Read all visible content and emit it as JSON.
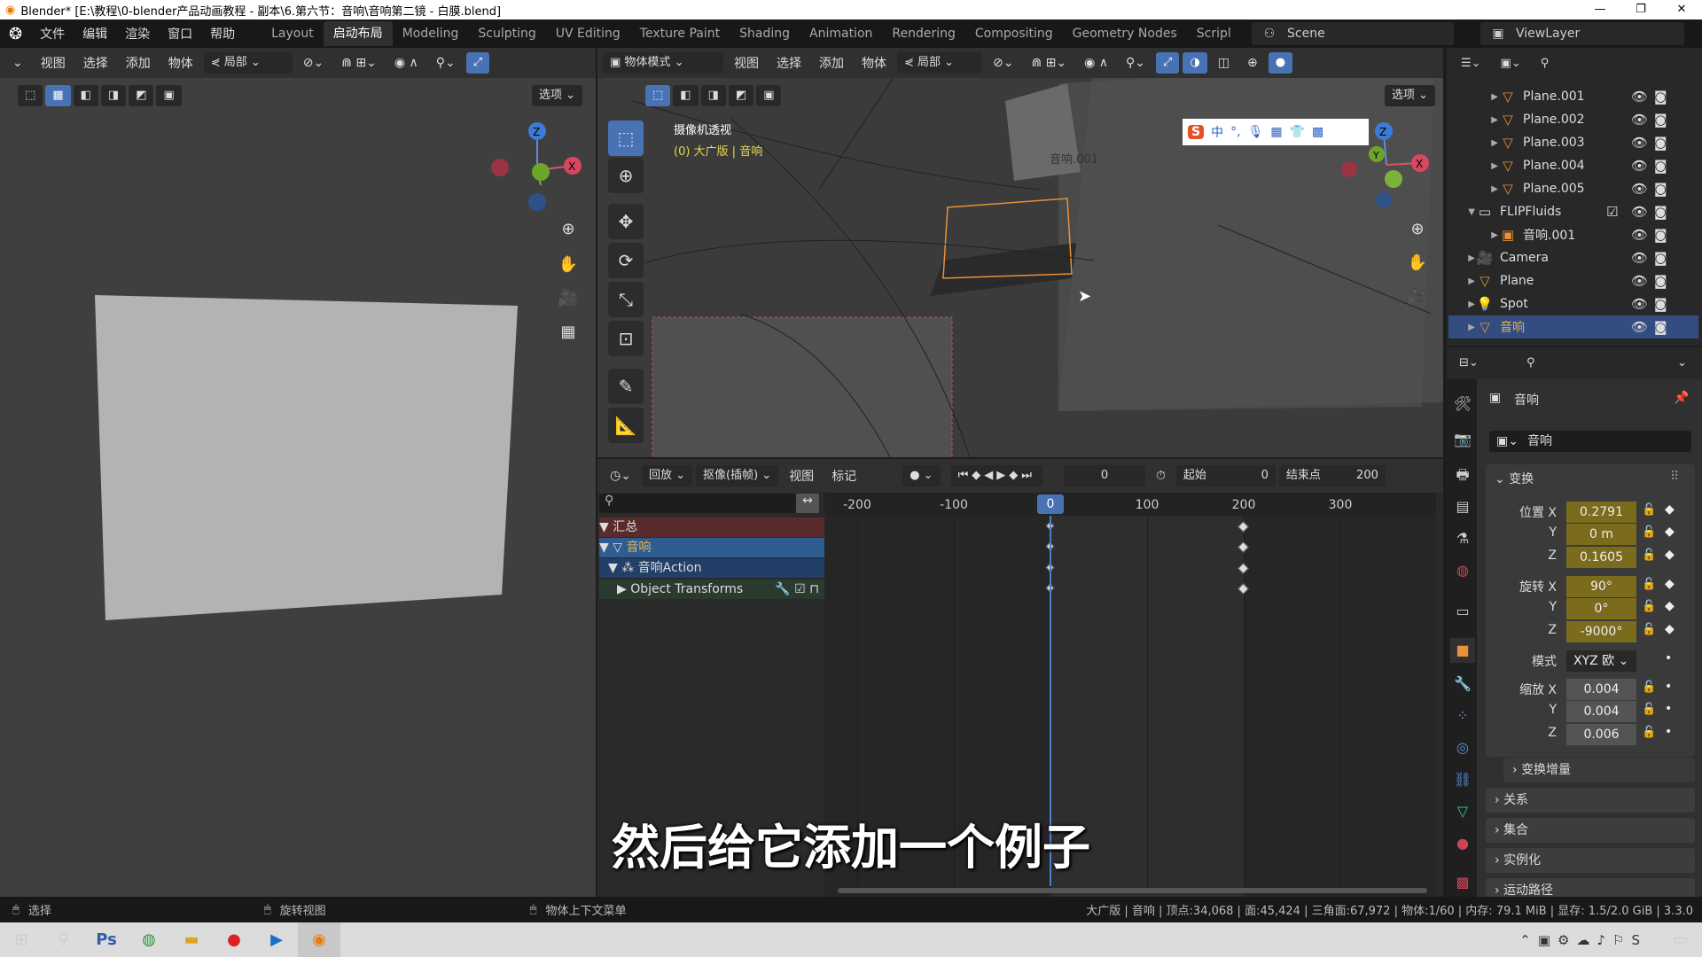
{
  "window": {
    "title": "Blender* [E:\\教程\\0-blender产品动画教程 - 副本\\6.第六节：音响\\音响第二镜 - 白膜.blend]",
    "controls": [
      "—",
      "❐",
      "✕"
    ]
  },
  "menus": [
    "文件",
    "编辑",
    "渲染",
    "窗口",
    "帮助"
  ],
  "workspaces": [
    {
      "label": "Layout"
    },
    {
      "label": "启动布局",
      "active": true
    },
    {
      "label": "Modeling"
    },
    {
      "label": "Sculpting"
    },
    {
      "label": "UV Editing"
    },
    {
      "label": "Texture Paint"
    },
    {
      "label": "Shading"
    },
    {
      "label": "Animation"
    },
    {
      "label": "Rendering"
    },
    {
      "label": "Compositing"
    },
    {
      "label": "Geometry Nodes"
    },
    {
      "label": "Scripl"
    }
  ],
  "scene": "Scene",
  "view_layer": "ViewLayer",
  "left_view": {
    "menus": [
      "视图",
      "选择",
      "添加",
      "物体"
    ],
    "transform_orientation": "局部",
    "options": "选项"
  },
  "mid_view": {
    "mode": "物体模式",
    "menus": [
      "视图",
      "选择",
      "添加",
      "物体"
    ],
    "transform_orientation": "局部",
    "options": "选项",
    "overlay_title": "摄像机透视",
    "overlay_sub": "(0) 大广版 | 音响",
    "object_label": "音响.001"
  },
  "ime_toolbar": [
    "S",
    "中",
    "°,",
    "🎙",
    "▦",
    "👕",
    "▩"
  ],
  "timeline": {
    "editor_menus": [
      "回放",
      "抠像(插帧)",
      "视图",
      "标记"
    ],
    "current_frame": "0",
    "start_label": "起始",
    "start": "0",
    "end_label": "结束点",
    "end": "200",
    "ticks": [
      "-200",
      "-100",
      "0",
      "100",
      "200",
      "300"
    ],
    "channels": [
      {
        "label": "汇总",
        "color": "#5a2b2b"
      },
      {
        "label": "音响",
        "color": "#2f5d91"
      },
      {
        "label": "音响Action",
        "color": "#223f68"
      },
      {
        "label": "Object Transforms",
        "color": "#2b3a2f"
      }
    ],
    "keyframes": [
      0,
      200
    ]
  },
  "outliner": {
    "items": [
      {
        "label": "Plane.001",
        "indent": 2,
        "icon": "mesh"
      },
      {
        "label": "Plane.002",
        "indent": 2,
        "icon": "mesh"
      },
      {
        "label": "Plane.003",
        "indent": 2,
        "icon": "mesh"
      },
      {
        "label": "Plane.004",
        "indent": 2,
        "icon": "mesh"
      },
      {
        "label": "Plane.005",
        "indent": 2,
        "icon": "mesh"
      },
      {
        "label": "FLIPFluids",
        "indent": 1,
        "icon": "collection",
        "expanded": true
      },
      {
        "label": "音响.001",
        "indent": 2,
        "icon": "object"
      },
      {
        "label": "Camera",
        "indent": 1,
        "icon": "camera"
      },
      {
        "label": "Plane",
        "indent": 1,
        "icon": "mesh"
      },
      {
        "label": "Spot",
        "indent": 1,
        "icon": "light"
      },
      {
        "label": "音响",
        "indent": 1,
        "icon": "mesh",
        "selected": true
      }
    ]
  },
  "properties": {
    "object_name": "音响",
    "data_name": "音响",
    "transform_title": "变换",
    "location": {
      "label": "位置 X",
      "x": "0.2791",
      "y": "0 m",
      "z": "0.1605"
    },
    "rotation": {
      "label": "旋转 X",
      "x": "90°",
      "y": "0°",
      "z": "-9000°"
    },
    "mode_label": "模式",
    "mode": "XYZ 欧",
    "scale": {
      "label": "缩放 X",
      "x": "0.004",
      "y": "0.004",
      "z": "0.006"
    },
    "axis_y": "Y",
    "axis_z": "Z",
    "panels": [
      "变换增量",
      "关系",
      "集合",
      "实例化",
      "运动路径"
    ]
  },
  "subtitle": "然后给它添加一个例子",
  "status": {
    "left": "选择",
    "middle": "旋转视图",
    "right": "物体上下文菜单",
    "stats": "大广版 | 音响 | 顶点:34,068 | 面:45,424 | 三角面:67,972 | 物体:1/60 | 内存: 79.1 MiB | 显存: 1.5/2.0 GiB | 3.3.0"
  },
  "colors": {
    "accent": "#4772b3",
    "animated_field": "#7a6b1d",
    "object_orange": "#e8903a"
  }
}
